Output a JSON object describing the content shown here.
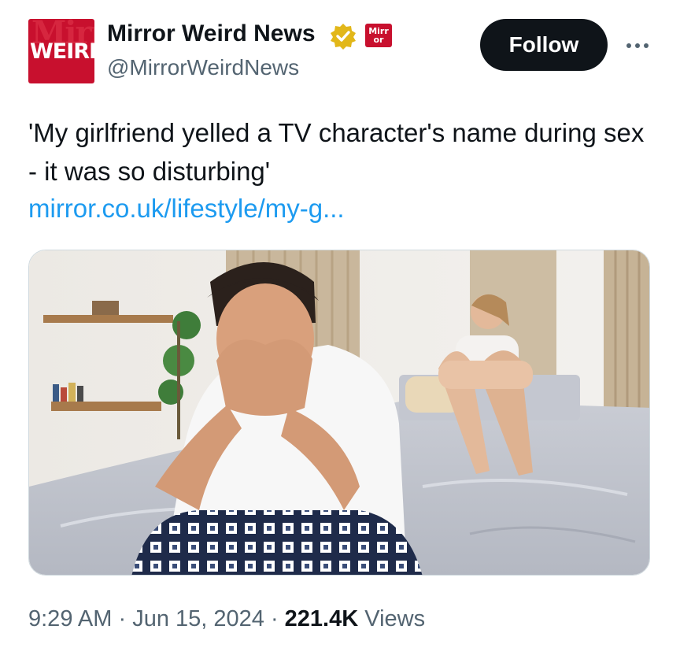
{
  "account": {
    "avatar_text": "WEIRD",
    "avatar_ghost_text": "Mirror",
    "display_name": "Mirror Weird News",
    "handle": "@MirrorWeirdNews",
    "affiliate_badge_text": "Mirr or",
    "follow_label": "Follow"
  },
  "tweet": {
    "text": "'My girlfriend yelled a TV character's name during sex - it was so disturbing'",
    "link": "mirror.co.uk/lifestyle/my-g..."
  },
  "meta": {
    "time": "9:29 AM",
    "sep1": " · ",
    "date": "Jun 15, 2024",
    "sep2": " · ",
    "views_count": "221.4K",
    "views_label": " Views"
  },
  "icons": {
    "verified": "verified-badge-icon",
    "more": "more-icon"
  },
  "colors": {
    "brand_red": "#c8102e",
    "verified_gold": "#e2b719",
    "link_blue": "#1d9bf0",
    "text_primary": "#0f1419",
    "text_secondary": "#536471"
  }
}
